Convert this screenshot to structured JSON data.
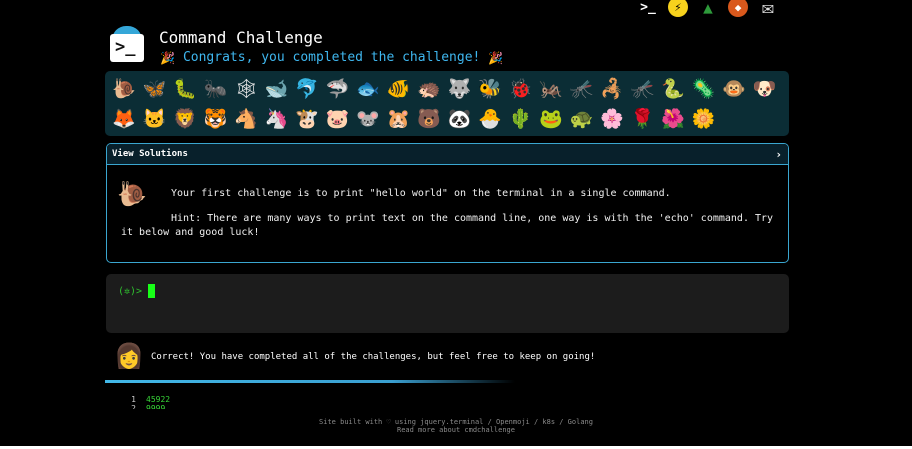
{
  "top_icons": [
    {
      "name": "terminal-icon",
      "glyph": ">_"
    },
    {
      "name": "lightning-icon",
      "glyph": "⚡"
    },
    {
      "name": "tree-icon",
      "glyph": "▲"
    },
    {
      "name": "fox-icon",
      "glyph": "◆"
    },
    {
      "name": "mail-icon",
      "glyph": "✉"
    }
  ],
  "header": {
    "logo_prompt": ">_",
    "title": "Command Challenge",
    "subtitle": "Congrats, you completed the challenge!",
    "party_icon": "🎉"
  },
  "emoji_grid": [
    "🐌",
    "🦋",
    "🐛",
    "🐜",
    "🕸",
    "🐋",
    "🐬",
    "🦈",
    "🐟",
    "🐠",
    "🦔",
    "🐺",
    "🐝",
    "🐞",
    "🦗",
    "🦟",
    "🦂",
    "🦟",
    "🐍",
    "🦠",
    "🐵",
    "🐶",
    "🦊",
    "🐱",
    "🦁",
    "🐯",
    "🐴",
    "🦄",
    "🐮",
    "🐷",
    "🐭",
    "🐹",
    "🐻",
    "🐼",
    "🐣",
    "🌵",
    "🐸",
    "🐢",
    "🌸",
    "🌹",
    "🌺",
    "🌼"
  ],
  "solutions": {
    "header": "View Solutions",
    "chevron": "›",
    "snail": "🐌",
    "challenge": "Your first challenge is to print \"hello world\" on the terminal in a single command.",
    "hint": "Hint: There are many ways to print text on the command line, one way is with the 'echo' command. Try it below and good luck!"
  },
  "terminal": {
    "prompt": "(✲)>"
  },
  "feedback": {
    "avatar": "👩",
    "message": "Correct! You have completed all of the challenges, but feel free to keep on going!"
  },
  "stats": [
    {
      "index": "1",
      "value": "45922"
    },
    {
      "index": "2",
      "value": "9999"
    }
  ],
  "footer": {
    "line1": "Site built with ♡ using jquery.terminal / Openmoji / k8s / Golang",
    "line2": "Read more about cmdchallenge"
  },
  "colors": {
    "accent": "#3fb7ef",
    "panel_border": "#3aa6d0",
    "grid_background": "#0b2d35",
    "terminal_background": "#1c1c1c",
    "prompt_green": "#2fc02f",
    "cursor_green": "#18ff18"
  }
}
